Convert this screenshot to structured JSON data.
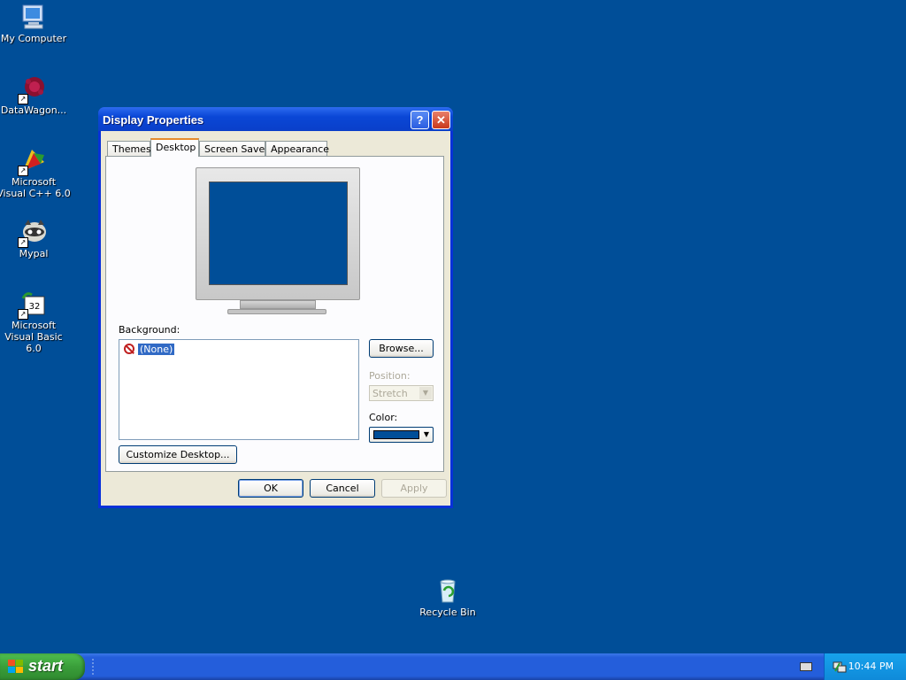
{
  "desktop": {
    "background_color": "#004e98",
    "icons": [
      {
        "label": "My Computer",
        "icon": "my-computer-icon"
      },
      {
        "label": "DataWagon...",
        "icon": "datawagon-icon"
      },
      {
        "label": "Microsoft Visual C++ 6.0",
        "icon": "visual-cpp-icon"
      },
      {
        "label": "Mypal",
        "icon": "mypal-icon"
      },
      {
        "label": "Microsoft Visual Basic 6.0",
        "icon": "visual-basic-icon"
      },
      {
        "label": "Recycle Bin",
        "icon": "recycle-bin-icon"
      }
    ]
  },
  "dialog": {
    "title": "Display Properties",
    "help_glyph": "?",
    "close_glyph": "✕",
    "tabs": [
      {
        "label": "Themes",
        "active": false
      },
      {
        "label": "Desktop",
        "active": true
      },
      {
        "label": "Screen Saver",
        "active": false
      },
      {
        "label": "Appearance",
        "active": false
      }
    ],
    "background_label": "Background:",
    "background_items": [
      {
        "label": "(None)",
        "selected": true,
        "icon": "none-icon"
      }
    ],
    "browse_label": "Browse...",
    "position_label": "Position:",
    "position_value": "Stretch",
    "color_label": "Color:",
    "color_value": "#004e98",
    "customize_label": "Customize Desktop...",
    "ok_label": "OK",
    "cancel_label": "Cancel",
    "apply_label": "Apply"
  },
  "taskbar": {
    "start_label": "start",
    "clock": "10:44 PM"
  }
}
